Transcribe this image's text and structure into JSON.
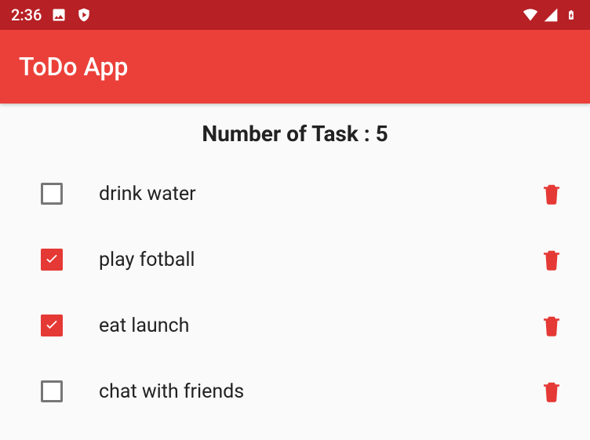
{
  "status": {
    "time": "2:36"
  },
  "appbar": {
    "title": "ToDo App"
  },
  "header": {
    "count_label": "Number of Task : 5"
  },
  "tasks": [
    {
      "label": "drink water",
      "checked": false
    },
    {
      "label": "play fotball",
      "checked": true
    },
    {
      "label": "eat launch",
      "checked": true
    },
    {
      "label": "chat with friends",
      "checked": false
    }
  ]
}
